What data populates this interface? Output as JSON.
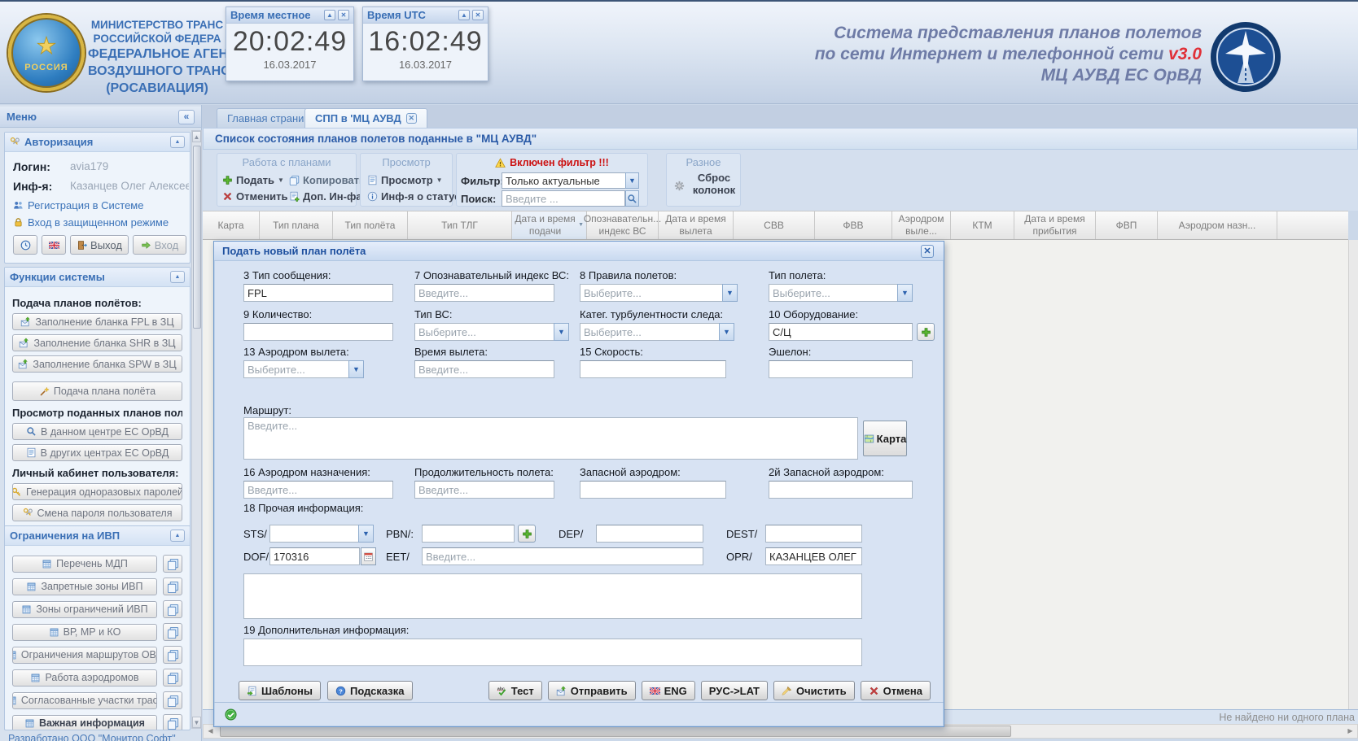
{
  "header": {
    "ministry_lines": [
      "МИНИСТЕРСТВО ТРАНС",
      "РОССИЙСКОЙ ФЕДЕРА",
      "ФЕДЕРАЛЬНОЕ АГЕН",
      "ВОЗДУШНОГО ТРАНС",
      "(РОСАВИАЦИЯ)"
    ],
    "left_logo_text": "РОССИЯ",
    "system_title": {
      "line1": "Система представления планов полетов",
      "line2": "по сети Интернет и телефонной сети",
      "version": "v3.0",
      "line3": "МЦ АУВД ЕС ОрВД"
    },
    "clocks": [
      {
        "title": "Время местное",
        "time": "20:02:49",
        "date": "16.03.2017"
      },
      {
        "title": "Время UTC",
        "time": "16:02:49",
        "date": "16.03.2017"
      }
    ]
  },
  "sidebar": {
    "menu_title": "Меню",
    "auth": {
      "title": "Авторизация",
      "login_label": "Логин:",
      "login_value": "avia179",
      "info_label": "Инф-я:",
      "info_value": "Казанцев Олег Алексееви",
      "link_register": "Регистрация в Системе",
      "link_secure": "Вход в защищенном режиме",
      "logout_label": "Выход",
      "enter_label": "Вход"
    },
    "functions": {
      "title": "Функции системы",
      "groups": [
        {
          "label": "Подача планов полётов:",
          "buttons": [
            {
              "label": "Заполнение бланка FPL в ЗЦ",
              "icon": "mail-up"
            },
            {
              "label": "Заполнение бланка SHR в ЗЦ",
              "icon": "mail-up"
            },
            {
              "label": "Заполнение бланка SPW в ЗЦ",
              "icon": "mail-up"
            },
            {
              "label": "Подача плана полёта",
              "icon": "wand",
              "gap": true
            }
          ]
        },
        {
          "label": "Просмотр поданных планов полётов:",
          "buttons": [
            {
              "label": "В данном центре ЕС ОрВД",
              "icon": "search"
            },
            {
              "label": "В других центрах ЕС ОрВД",
              "icon": "doc"
            }
          ]
        },
        {
          "label": "Личный кабинет пользователя:",
          "buttons": [
            {
              "label": "Генерация одноразовых паролей",
              "icon": "key"
            },
            {
              "label": "Смена пароля пользователя",
              "icon": "keys"
            }
          ]
        }
      ]
    },
    "restrictions": {
      "title": "Ограничения на ИВП",
      "items": [
        "Перечень МДП",
        "Запретные зоны ИВП",
        "Зоны ограничений ИВП",
        "ВР, МР и КО",
        "Ограничения маршрутов ОВД",
        "Работа аэродромов",
        "Согласованные участки трасс",
        "Важная информация"
      ]
    },
    "footer": "Разработано ООО \"Монитор Софт\""
  },
  "main": {
    "tabs": [
      {
        "label": "Главная страница"
      },
      {
        "label": "СПП в 'МЦ АУВД",
        "active": true
      }
    ],
    "panel_title": "Список состояния планов полетов поданные в \"МЦ АУВД\"",
    "toolbar": {
      "group1_title": "Работа с планами",
      "submit": "Подать",
      "copy": "Копировать",
      "cancel": "Отменить",
      "extra_info": "Доп. Ин-фа",
      "group2_title": "Просмотр",
      "view": "Просмотр",
      "status_info": "Инф-я о статусе",
      "filter_warning": "Включен фильтр !!!",
      "filter_label": "Фильтр:",
      "filter_value": "Только актуальные",
      "search_label": "Поиск:",
      "search_placeholder": "Введите ...",
      "group3_title": "Разное",
      "reset_columns": "Сброс колонок"
    },
    "table": {
      "columns": [
        "Карта",
        "Тип плана",
        "Тип полёта",
        "Тип ТЛГ",
        "Дата и время подачи",
        "Опознавательн... индекс ВС",
        "Дата и время вылета",
        "СВВ",
        "ФВВ",
        "Аэродром выле...",
        "КТМ",
        "Дата и время прибытия",
        "ФВП",
        "Аэродром назн..."
      ],
      "sorted_index": 4,
      "empty_text": "Не найдено ни одного плана"
    }
  },
  "dialog": {
    "title": "Подать новый план полёта",
    "fields": {
      "msg_type": {
        "label": "3 Тип сообщения:",
        "value": "FPL"
      },
      "acid": {
        "label": "7 Опознавательный индекс ВС:",
        "placeholder": "Введите..."
      },
      "rules": {
        "label": "8 Правила полетов:",
        "placeholder": "Выберите..."
      },
      "flight_type": {
        "label": "Тип полета:",
        "placeholder": "Выберите..."
      },
      "number": {
        "label": "9 Количество:",
        "value": ""
      },
      "ac_type": {
        "label": "Тип ВС:",
        "placeholder": "Выберите..."
      },
      "wake": {
        "label": "Катег. турбулентности следа:",
        "placeholder": "Выберите..."
      },
      "equipment": {
        "label": "10 Оборудование:",
        "value": "С/Ц"
      },
      "dep_ad": {
        "label": "13 Аэродром вылета:",
        "placeholder": "Выберите..."
      },
      "dep_time": {
        "label": "Время вылета:",
        "placeholder": "Введите..."
      },
      "speed": {
        "label": "15 Скорость:",
        "value": ""
      },
      "level": {
        "label": "Эшелон:",
        "value": ""
      },
      "route": {
        "label": "Маршрут:",
        "placeholder": "Введите...",
        "map_button": "Карта"
      },
      "dest_ad": {
        "label": "16 Аэродром назначения:",
        "placeholder": "Введите..."
      },
      "duration": {
        "label": "Продолжительность полета:",
        "placeholder": "Введите..."
      },
      "altn": {
        "label": "Запасной аэродром:",
        "value": ""
      },
      "altn2": {
        "label": "2й Запасной аэродром:",
        "value": ""
      },
      "other_info_label": "18 Прочая информация:",
      "sts": {
        "label": "STS/"
      },
      "pbn": {
        "label": "PBN/:"
      },
      "dep": {
        "label": "DEP/"
      },
      "dest": {
        "label": "DEST/"
      },
      "dof": {
        "label": "DOF/",
        "value": "170316"
      },
      "eet": {
        "label": "EET/",
        "placeholder": "Введите..."
      },
      "opr": {
        "label": "OPR/",
        "value": "КАЗАНЦЕВ ОЛЕГ АЛЕКС"
      },
      "add_info_label": "19 Дополнительная информация:"
    },
    "buttons_left": [
      {
        "label": "Шаблоны",
        "icon": "doc-green"
      },
      {
        "label": "Подсказка",
        "icon": "question"
      }
    ],
    "buttons_right": [
      {
        "label": "Тест",
        "icon": "abc"
      },
      {
        "label": "Отправить",
        "icon": "mail-up"
      },
      {
        "label": "ENG",
        "icon": "flag-uk"
      },
      {
        "label": "РУС->LAT",
        "icon": ""
      },
      {
        "label": "Очистить",
        "icon": "broom"
      },
      {
        "label": "Отмена",
        "icon": "x-red"
      }
    ]
  }
}
